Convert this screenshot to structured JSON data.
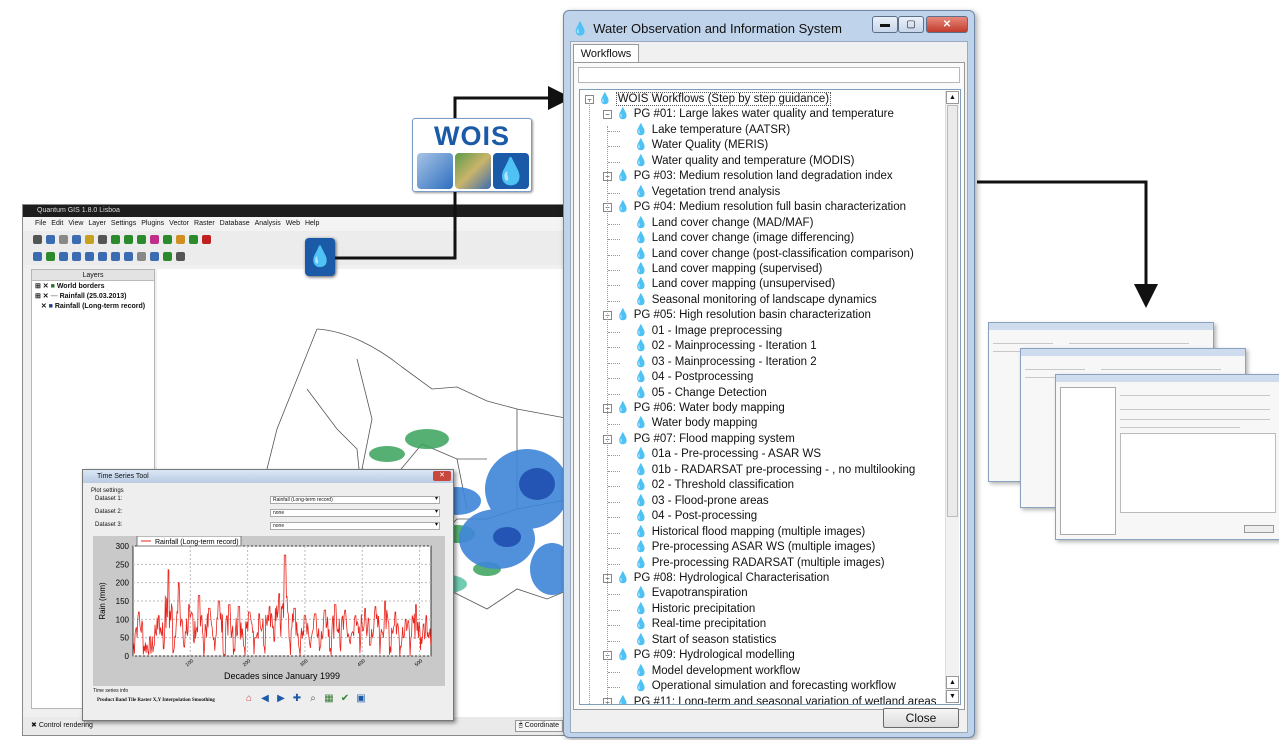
{
  "qgis": {
    "title": "Quantum GIS 1.8.0 Lisboa",
    "menu": [
      "File",
      "Edit",
      "View",
      "Layer",
      "Settings",
      "Plugins",
      "Vector",
      "Raster",
      "Database",
      "Analysis",
      "Web",
      "Help"
    ],
    "layers_panel_title": "Layers",
    "layers": [
      "World borders",
      "Rainfall (25.03.2013)",
      "Rainfall (Long-term record)"
    ],
    "status_left": "Control rendering",
    "status_coordinate": "Coordinate"
  },
  "logo": {
    "text": "WOIS"
  },
  "timeseries": {
    "title": "Time Series Tool",
    "plot_settings": "Plot settings",
    "datasets": [
      {
        "label": "Dataset 1:",
        "value": "Rainfall (Long-term record)"
      },
      {
        "label": "Dataset 2:",
        "value": "none"
      },
      {
        "label": "Dataset 3:",
        "value": "none"
      }
    ],
    "info_label": "Time series info",
    "info_headers": "Product  Band  Tile  Raster X,Y  Interpolation  Smoothing",
    "tools": [
      "home-icon",
      "back-icon",
      "forward-icon",
      "pan-icon",
      "zoom-icon",
      "configure-icon",
      "save-icon",
      "check-icon",
      "export-icon"
    ]
  },
  "chart_data": {
    "type": "line",
    "title": "",
    "xlabel": "Decades since January 1999",
    "ylabel": "Rain (mm)",
    "ylim": [
      0,
      300
    ],
    "xlim": [
      0,
      520
    ],
    "yticks": [
      0,
      50,
      100,
      150,
      200,
      250,
      300
    ],
    "xticks": [
      100,
      200,
      300,
      400,
      500
    ],
    "legend": "Rainfall (Long-term record)",
    "legend_position": "top-left",
    "grid": true,
    "series_color": "#e8231c",
    "peaks": [
      [
        10,
        120
      ],
      [
        45,
        110
      ],
      [
        62,
        235
      ],
      [
        80,
        200
      ],
      [
        98,
        140
      ],
      [
        115,
        165
      ],
      [
        133,
        130
      ],
      [
        150,
        150
      ],
      [
        168,
        140
      ],
      [
        185,
        135
      ],
      [
        203,
        120
      ],
      [
        220,
        115
      ],
      [
        238,
        135
      ],
      [
        255,
        170
      ],
      [
        265,
        275
      ],
      [
        282,
        130
      ],
      [
        300,
        110
      ],
      [
        318,
        115
      ],
      [
        335,
        125
      ],
      [
        353,
        140
      ],
      [
        370,
        125
      ],
      [
        388,
        110
      ],
      [
        405,
        130
      ],
      [
        423,
        135
      ],
      [
        440,
        150
      ],
      [
        458,
        120
      ],
      [
        476,
        100
      ],
      [
        494,
        140
      ],
      [
        512,
        110
      ]
    ]
  },
  "dialog": {
    "title": "Water Observation and Information System",
    "tab": "Workflows",
    "close_label": "Close",
    "tree": [
      {
        "level": 0,
        "label": "WOIS Workflows (Step by step guidance)",
        "expander": "⊟"
      },
      {
        "level": 1,
        "label": "PG #01: Large lakes water quality and temperature",
        "expander": "⊟"
      },
      {
        "level": 2,
        "label": "Lake temperature (AATSR)"
      },
      {
        "level": 2,
        "label": "Water Quality (MERIS)"
      },
      {
        "level": 2,
        "label": "Water quality and temperature (MODIS)"
      },
      {
        "level": 1,
        "label": "PG #03: Medium resolution land degradation index",
        "expander": "⊟"
      },
      {
        "level": 2,
        "label": "Vegetation trend analysis"
      },
      {
        "level": 1,
        "label": "PG #04: Medium resolution full basin characterization",
        "expander": "⊟"
      },
      {
        "level": 2,
        "label": "Land cover change (MAD/MAF)"
      },
      {
        "level": 2,
        "label": "Land cover change (image differencing)"
      },
      {
        "level": 2,
        "label": "Land cover change (post-classification comparison)"
      },
      {
        "level": 2,
        "label": "Land cover mapping (supervised)"
      },
      {
        "level": 2,
        "label": "Land cover mapping (unsupervised)"
      },
      {
        "level": 2,
        "label": "Seasonal monitoring of landscape dynamics"
      },
      {
        "level": 1,
        "label": "PG #05: High resolution basin characterization",
        "expander": "⊟"
      },
      {
        "level": 2,
        "label": "01 - Image preprocessing"
      },
      {
        "level": 2,
        "label": "02 - Mainprocessing - Iteration 1"
      },
      {
        "level": 2,
        "label": "03 - Mainprocessing - Iteration 2"
      },
      {
        "level": 2,
        "label": "04 - Postprocessing"
      },
      {
        "level": 2,
        "label": "05 - Change Detection"
      },
      {
        "level": 1,
        "label": "PG #06: Water body mapping",
        "expander": "⊟"
      },
      {
        "level": 2,
        "label": "Water body mapping"
      },
      {
        "level": 1,
        "label": "PG #07: Flood mapping system",
        "expander": "⊟"
      },
      {
        "level": 2,
        "label": "01a - Pre-processing - ASAR WS"
      },
      {
        "level": 2,
        "label": "01b - RADARSAT pre-processing - , no multilooking"
      },
      {
        "level": 2,
        "label": "02 - Threshold classification"
      },
      {
        "level": 2,
        "label": "03 - Flood-prone areas"
      },
      {
        "level": 2,
        "label": "04 - Post-processing"
      },
      {
        "level": 2,
        "label": "Historical flood mapping (multiple images)"
      },
      {
        "level": 2,
        "label": "Pre-processing ASAR WS (multiple images)"
      },
      {
        "level": 2,
        "label": "Pre-processing RADARSAT (multiple images)"
      },
      {
        "level": 1,
        "label": "PG #08: Hydrological Characterisation",
        "expander": "⊟"
      },
      {
        "level": 2,
        "label": "Evapotranspiration"
      },
      {
        "level": 2,
        "label": "Historic precipitation"
      },
      {
        "level": 2,
        "label": "Real-time precipitation"
      },
      {
        "level": 2,
        "label": "Start of season statistics"
      },
      {
        "level": 1,
        "label": "PG #09: Hydrological modelling",
        "expander": "⊟"
      },
      {
        "level": 2,
        "label": "Model development workflow"
      },
      {
        "level": 2,
        "label": "Operational simulation and forecasting workflow"
      },
      {
        "level": 1,
        "label": "PG #11: Long-term and seasonal variation of wetland areas",
        "expander": "⊟"
      }
    ]
  },
  "colors": {
    "wois_blue": "#1b5aa6",
    "dialog_frame": "#bfd3ea",
    "rain_line": "#e8231c",
    "close_red": "#c8463c"
  }
}
